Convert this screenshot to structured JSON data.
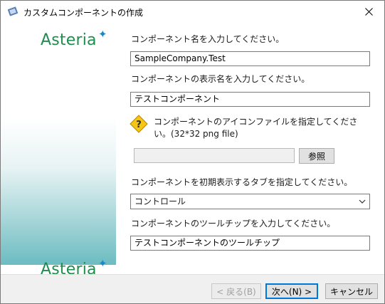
{
  "window": {
    "title": "カスタムコンポーネントの作成"
  },
  "branding": {
    "logo_top": "Asteria",
    "logo_bottom": "Asteria"
  },
  "form": {
    "component_name_label": "コンポーネント名を入力してください。",
    "component_name_value": "SampleCompany.Test",
    "display_name_label": "コンポーネントの表示名を入力してください。",
    "display_name_value": "テストコンポーネント",
    "icon_label_line1": "コンポーネントのアイコンファイルを指定してくださ",
    "icon_label_line2": "い。(32*32 png file)",
    "icon_path_value": "",
    "browse_label": "参照",
    "tab_label": "コンポーネントを初期表示するタブを指定してください。",
    "tab_selected": "コントロール",
    "tooltip_label": "コンポーネントのツールチップを入力してください。",
    "tooltip_value": "テストコンポーネントのツールチップ"
  },
  "footer": {
    "back_label": "< 戻る(B)",
    "next_label": "次へ(N) >",
    "cancel_label": "キャンセル"
  },
  "colors": {
    "accent": "#0078d7",
    "logo_green": "#1e8e4e",
    "logo_blue": "#1c86c7",
    "sidebar_teal": "#5fb7bc",
    "warning_yellow": "#f5c518"
  },
  "icons": {
    "title": "app-icon",
    "close": "close-icon",
    "warning": "question-warning-icon",
    "dropdown": "chevron-down-icon",
    "logo_spark": "sparkle-icon"
  }
}
